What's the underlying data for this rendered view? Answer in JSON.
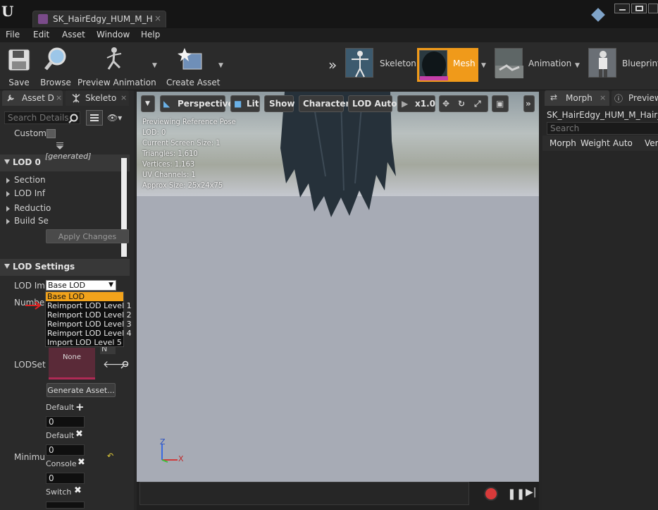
{
  "window": {
    "tab_title": "SK_HairEdgy_HUM_M_Hai",
    "tab_close": "×"
  },
  "menu": [
    "File",
    "Edit",
    "Asset",
    "Window",
    "Help"
  ],
  "toolbar": {
    "save_label": "Save",
    "browse_label": "Browse",
    "preview_animation_label": "Preview Animation",
    "create_asset_label": "Create Asset",
    "modes": [
      {
        "label": "Skeleton",
        "icon": "skeleton-icon",
        "active": false
      },
      {
        "label": "Mesh",
        "icon": "mesh-icon",
        "active": true
      },
      {
        "label": "Animation",
        "icon": "animation-icon",
        "active": false
      },
      {
        "label": "Blueprint",
        "icon": "blueprint-icon",
        "active": false
      }
    ],
    "active_color": "#f09a1a"
  },
  "left_panel": {
    "tabs": [
      {
        "label": "Asset D",
        "close": "×"
      },
      {
        "label": "Skeleto",
        "close": "×"
      }
    ],
    "search_placeholder": "Search Details",
    "custom_label": "Custom",
    "generated_label": "[generated]",
    "lod0": {
      "title": "LOD 0",
      "items": [
        "Section",
        "LOD Inf",
        "Reductio",
        "Build Se"
      ],
      "apply_changes": "Apply Changes"
    },
    "lod_settings": {
      "title": "LOD Settings",
      "lod_import_label": "LOD Imp",
      "selected": "Base LOD",
      "options": [
        "Base LOD",
        "Reimport LOD Level 1",
        "Reimport LOD Level 2",
        "Reimport LOD Level 3",
        "Reimport LOD Level 4",
        "Import LOD Level 5"
      ],
      "number_label": "Number",
      "n_label": "N",
      "lodset_label": "LODSet",
      "lodset_value": "None",
      "generate_asset": "Generate Asset...",
      "default1_label": "Default",
      "default1_value": "0",
      "default2_label": "Default",
      "default2_value": "0",
      "minimum_label": "Minimu",
      "console_label": "Console",
      "console_value": "0",
      "switch_label": "Switch"
    }
  },
  "viewport": {
    "buttons": {
      "perspective": "Perspective",
      "lit": "Lit",
      "show": "Show",
      "character": "Character",
      "lod_auto": "LOD Auto",
      "speed": "x1.0"
    },
    "stats": [
      "Previewing Reference Pose",
      "LOD: 0",
      "Current Screen Size: 1",
      "Triangles: 1,610",
      "Vertices: 1,163",
      "UV Channels: 1",
      "Approx Size: 25x24x75"
    ],
    "axis": {
      "z": "Z",
      "x": "X"
    }
  },
  "right_panel": {
    "tabs": [
      {
        "label": "Morph",
        "close": "×"
      },
      {
        "label": "Preview"
      }
    ],
    "asset_name": "SK_HairEdgy_HUM_M_Hair_Cl",
    "search_placeholder": "Search",
    "columns": [
      "Morph",
      "Weight",
      "Auto",
      "Ver"
    ]
  }
}
